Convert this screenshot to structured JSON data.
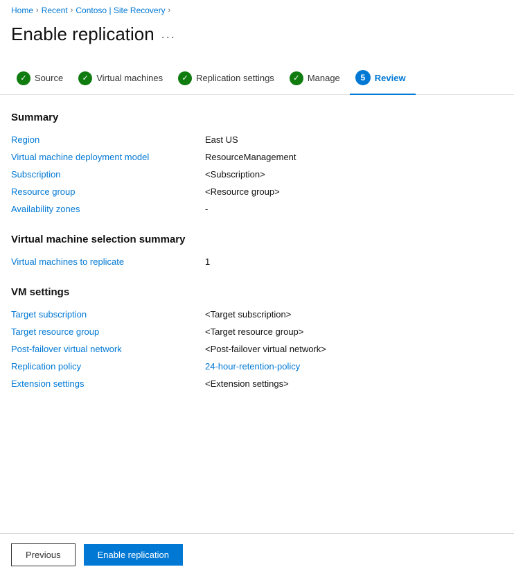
{
  "breadcrumb": {
    "home": "Home",
    "recent": "Recent",
    "contoso": "Contoso",
    "site_recovery": "Site Recovery"
  },
  "page": {
    "title": "Enable replication",
    "dots": "..."
  },
  "wizard": {
    "steps": [
      {
        "id": "source",
        "label": "Source",
        "type": "check",
        "active": false
      },
      {
        "id": "virtual-machines",
        "label": "Virtual machines",
        "type": "check",
        "active": false
      },
      {
        "id": "replication-settings",
        "label": "Replication settings",
        "type": "check",
        "active": false
      },
      {
        "id": "manage",
        "label": "Manage",
        "type": "check",
        "active": false
      },
      {
        "id": "review",
        "label": "Review",
        "type": "number",
        "number": "5",
        "active": true
      }
    ]
  },
  "summary": {
    "heading": "Summary",
    "rows": [
      {
        "label": "Region",
        "value": "East US",
        "link": false
      },
      {
        "label": "Virtual machine deployment model",
        "value": "ResourceManagement",
        "link": false
      },
      {
        "label": "Subscription",
        "value": "<Subscription>",
        "link": false
      },
      {
        "label": "Resource group",
        "value": "<Resource group>",
        "link": false
      },
      {
        "label": "Availability zones",
        "value": "-",
        "link": false
      }
    ]
  },
  "vm_selection": {
    "heading": "Virtual machine selection summary",
    "rows": [
      {
        "label": "Virtual machines to replicate",
        "value": "1",
        "link": false
      }
    ]
  },
  "vm_settings": {
    "heading": "VM settings",
    "rows": [
      {
        "label": "Target subscription",
        "value": "<Target subscription>",
        "link": false
      },
      {
        "label": "Target resource group",
        "value": "<Target resource group>",
        "link": false
      },
      {
        "label": "Post-failover virtual network",
        "value": "<Post-failover virtual network>",
        "link": false
      },
      {
        "label": "Replication policy",
        "value": "24-hour-retention-policy",
        "link": true
      },
      {
        "label": "Extension settings",
        "value": "<Extension settings>",
        "link": false
      }
    ]
  },
  "footer": {
    "previous_label": "Previous",
    "enable_label": "Enable replication"
  },
  "icons": {
    "check": "✓",
    "chevron": "›"
  }
}
